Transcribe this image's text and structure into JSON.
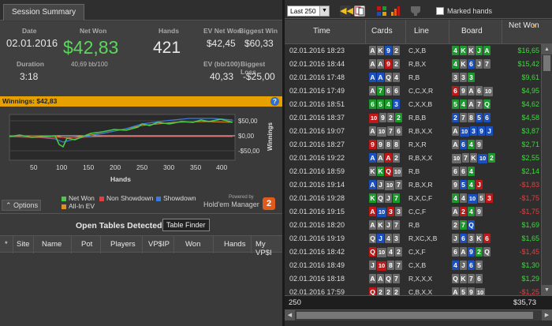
{
  "left": {
    "tab_label": "Session Summary",
    "summary": {
      "date_label": "Date",
      "date": "02.01.2016",
      "duration_label": "Duration",
      "duration": "3:18",
      "net_won_label": "Net Won",
      "net_won": "$42,83",
      "net_won_bb": "40,69 bb/100",
      "hands_label": "Hands",
      "hands": "421",
      "ev_net_won_label": "EV Net Won",
      "ev_net_won": "$42,45",
      "biggest_win_label": "Biggest Win",
      "biggest_win": "$60,33",
      "ev_bb_label": "EV (bb/100)",
      "ev_bb": "40,33",
      "biggest_loss_label": "Biggest Loss",
      "biggest_loss": "-$25,00"
    },
    "winnings_bar": "Winnings: $42,83",
    "graph": {
      "ytick_top": "$50,00",
      "ytick_mid": "$0,00",
      "ytick_bot": "-$50,00",
      "ylabel": "Winnings",
      "xticks": [
        "50",
        "100",
        "150",
        "200",
        "250",
        "300",
        "350",
        "400"
      ],
      "xlabel": "Hands"
    },
    "options_label": "Options",
    "legend": {
      "net_won": "Net Won",
      "non_showdown": "Non Showdown",
      "showdown": "Showdown",
      "all_in_ev": "All-In EV"
    },
    "powered_by": "Powered by",
    "brand": "Hold'em Manager",
    "brand_logo": "2",
    "open_tables": {
      "title": "Open Tables Detected",
      "finder_button": "Table Finder",
      "columns": [
        "*",
        "Site",
        "Name",
        "Pot",
        "Players",
        "VP$IP",
        "Won",
        "Hands",
        "My VP$I"
      ]
    }
  },
  "right": {
    "filter_select": "Last 250",
    "marked_hands_label": "Marked hands",
    "columns": {
      "time": "Time",
      "cards": "Cards",
      "line": "Line",
      "board": "Board",
      "net_won": "Net Won"
    },
    "rows": [
      {
        "time": "02.01.2016 18:23",
        "cards": [
          [
            "A",
            "s"
          ],
          [
            "K",
            "s"
          ],
          [
            "9",
            "d"
          ],
          [
            "2",
            "s"
          ]
        ],
        "line": "C,X,B",
        "board": [
          [
            "4",
            "c"
          ],
          [
            "K",
            "c"
          ],
          [
            "K",
            "s"
          ],
          [
            "J",
            "c"
          ],
          [
            "A",
            "c"
          ]
        ],
        "won": "$16,65",
        "color": "#3adc3a"
      },
      {
        "time": "02.01.2016 18:44",
        "cards": [
          [
            "A",
            "s"
          ],
          [
            "A",
            "s"
          ],
          [
            "9",
            "h"
          ],
          [
            "2",
            "s"
          ]
        ],
        "line": "R,B,X",
        "board": [
          [
            "4",
            "c"
          ],
          [
            "K",
            "s"
          ],
          [
            "6",
            "d"
          ],
          [
            "J",
            "s"
          ],
          [
            "7",
            "s"
          ]
        ],
        "won": "$15,42",
        "color": "#3adc3a"
      },
      {
        "time": "02.01.2016 17:48",
        "cards": [
          [
            "A",
            "d"
          ],
          [
            "A",
            "d"
          ],
          [
            "Q",
            "s"
          ],
          [
            "4",
            "s"
          ]
        ],
        "line": "R,B",
        "board": [
          [
            "3",
            "s"
          ],
          [
            "3",
            "s"
          ],
          [
            "3",
            "c"
          ]
        ],
        "won": "$9,61",
        "color": "#3adc3a"
      },
      {
        "time": "02.01.2016 17:49",
        "cards": [
          [
            "A",
            "s"
          ],
          [
            "7",
            "c"
          ],
          [
            "6",
            "s"
          ],
          [
            "6",
            "s"
          ]
        ],
        "line": "C,C,X,R",
        "board": [
          [
            "6",
            "h"
          ],
          [
            "9",
            "s"
          ],
          [
            "A",
            "s"
          ],
          [
            "6",
            "s"
          ],
          [
            "10",
            "s"
          ]
        ],
        "won": "$4,95",
        "color": "#3adc3a"
      },
      {
        "time": "02.01.2016 18:51",
        "cards": [
          [
            "6",
            "c"
          ],
          [
            "5",
            "c"
          ],
          [
            "4",
            "c"
          ],
          [
            "3",
            "d"
          ]
        ],
        "line": "C,X,X,B",
        "board": [
          [
            "5",
            "c"
          ],
          [
            "4",
            "c"
          ],
          [
            "A",
            "s"
          ],
          [
            "7",
            "s"
          ],
          [
            "Q",
            "c"
          ]
        ],
        "won": "$4,62",
        "color": "#3adc3a"
      },
      {
        "time": "02.01.2016 18:37",
        "cards": [
          [
            "10",
            "h"
          ],
          [
            "9",
            "s"
          ],
          [
            "2",
            "s"
          ],
          [
            "2",
            "c"
          ]
        ],
        "line": "R,B,B",
        "board": [
          [
            "2",
            "d"
          ],
          [
            "7",
            "s"
          ],
          [
            "8",
            "s"
          ],
          [
            "5",
            "d"
          ],
          [
            "6",
            "d"
          ]
        ],
        "won": "$4,58",
        "color": "#3adc3a"
      },
      {
        "time": "02.01.2016 19:07",
        "cards": [
          [
            "A",
            "s"
          ],
          [
            "10",
            "s"
          ],
          [
            "7",
            "s"
          ],
          [
            "6",
            "s"
          ]
        ],
        "line": "R,B,X,X",
        "board": [
          [
            "A",
            "s"
          ],
          [
            "10",
            "d"
          ],
          [
            "3",
            "d"
          ],
          [
            "9",
            "d"
          ],
          [
            "J",
            "d"
          ]
        ],
        "won": "$3,87",
        "color": "#3adc3a"
      },
      {
        "time": "02.01.2016 18:27",
        "cards": [
          [
            "9",
            "h"
          ],
          [
            "9",
            "s"
          ],
          [
            "8",
            "s"
          ],
          [
            "8",
            "s"
          ]
        ],
        "line": "R,X,R",
        "board": [
          [
            "A",
            "s"
          ],
          [
            "6",
            "d"
          ],
          [
            "4",
            "c"
          ],
          [
            "9",
            "s"
          ]
        ],
        "won": "$2,71",
        "color": "#3adc3a"
      },
      {
        "time": "02.01.2016 19:22",
        "cards": [
          [
            "A",
            "d"
          ],
          [
            "A",
            "s"
          ],
          [
            "A",
            "h"
          ],
          [
            "2",
            "s"
          ]
        ],
        "line": "R,B,X,X",
        "board": [
          [
            "10",
            "s"
          ],
          [
            "7",
            "s"
          ],
          [
            "K",
            "s"
          ],
          [
            "10",
            "d"
          ],
          [
            "2",
            "c"
          ]
        ],
        "won": "$2,55",
        "color": "#3adc3a"
      },
      {
        "time": "02.01.2016 18:59",
        "cards": [
          [
            "K",
            "s"
          ],
          [
            "K",
            "c"
          ],
          [
            "Q",
            "h"
          ],
          [
            "10",
            "s"
          ]
        ],
        "line": "R,B",
        "board": [
          [
            "6",
            "s"
          ],
          [
            "6",
            "s"
          ],
          [
            "4",
            "c"
          ]
        ],
        "won": "$2,14",
        "color": "#3adc3a"
      },
      {
        "time": "02.01.2016 19:14",
        "cards": [
          [
            "A",
            "d"
          ],
          [
            "J",
            "s"
          ],
          [
            "10",
            "s"
          ],
          [
            "7",
            "s"
          ]
        ],
        "line": "R,B,X,R",
        "board": [
          [
            "9",
            "s"
          ],
          [
            "5",
            "d"
          ],
          [
            "4",
            "c"
          ],
          [
            "J",
            "h"
          ]
        ],
        "won": "-$1,83",
        "color": "#e04040"
      },
      {
        "time": "02.01.2016 19:28",
        "cards": [
          [
            "K",
            "c"
          ],
          [
            "Q",
            "s"
          ],
          [
            "J",
            "s"
          ],
          [
            "7",
            "c"
          ]
        ],
        "line": "R,X,C,F",
        "board": [
          [
            "4",
            "c"
          ],
          [
            "4",
            "s"
          ],
          [
            "10",
            "d"
          ],
          [
            "5",
            "s"
          ],
          [
            "3",
            "h"
          ]
        ],
        "won": "-$1,75",
        "color": "#e04040"
      },
      {
        "time": "02.01.2016 19:15",
        "cards": [
          [
            "A",
            "h"
          ],
          [
            "10",
            "d"
          ],
          [
            "3",
            "h"
          ],
          [
            "3",
            "s"
          ]
        ],
        "line": "C,C,F",
        "board": [
          [
            "A",
            "s"
          ],
          [
            "2",
            "h"
          ],
          [
            "4",
            "c"
          ],
          [
            "9",
            "s"
          ]
        ],
        "won": "-$1,75",
        "color": "#e04040"
      },
      {
        "time": "02.01.2016 18:20",
        "cards": [
          [
            "A",
            "s"
          ],
          [
            "K",
            "s"
          ],
          [
            "J",
            "s"
          ],
          [
            "7",
            "s"
          ]
        ],
        "line": "R,B",
        "board": [
          [
            "2",
            "s"
          ],
          [
            "7",
            "c"
          ],
          [
            "Q",
            "d"
          ]
        ],
        "won": "$1,69",
        "color": "#3adc3a"
      },
      {
        "time": "02.01.2016 19:19",
        "cards": [
          [
            "Q",
            "s"
          ],
          [
            "J",
            "d"
          ],
          [
            "4",
            "s"
          ],
          [
            "3",
            "s"
          ]
        ],
        "line": "R,XC,X,B",
        "board": [
          [
            "J",
            "s"
          ],
          [
            "6",
            "d"
          ],
          [
            "3",
            "s"
          ],
          [
            "K",
            "s"
          ],
          [
            "6",
            "h"
          ]
        ],
        "won": "$1,65",
        "color": "#3adc3a"
      },
      {
        "time": "02.01.2016 18:42",
        "cards": [
          [
            "Q",
            "h"
          ],
          [
            "10",
            "s"
          ],
          [
            "4",
            "s"
          ],
          [
            "2",
            "s"
          ]
        ],
        "line": "C,X,F",
        "board": [
          [
            "6",
            "s"
          ],
          [
            "A",
            "s"
          ],
          [
            "9",
            "d"
          ],
          [
            "2",
            "c"
          ],
          [
            "Q",
            "s"
          ]
        ],
        "won": "-$1,45",
        "color": "#e04040"
      },
      {
        "time": "02.01.2016 18:49",
        "cards": [
          [
            "J",
            "s"
          ],
          [
            "10",
            "h"
          ],
          [
            "8",
            "s"
          ],
          [
            "7",
            "s"
          ]
        ],
        "line": "C,X,B",
        "board": [
          [
            "4",
            "d"
          ],
          [
            "J",
            "s"
          ],
          [
            "6",
            "d"
          ],
          [
            "5",
            "s"
          ]
        ],
        "won": "$1,30",
        "color": "#3adc3a"
      },
      {
        "time": "02.01.2016 18:18",
        "cards": [
          [
            "A",
            "s"
          ],
          [
            "A",
            "s"
          ],
          [
            "Q",
            "s"
          ],
          [
            "7",
            "s"
          ]
        ],
        "line": "R,X,X,X",
        "board": [
          [
            "Q",
            "s"
          ],
          [
            "K",
            "s"
          ],
          [
            "7",
            "s"
          ],
          [
            "6",
            "s"
          ]
        ],
        "won": "$1,29",
        "color": "#3adc3a"
      },
      {
        "time": "02.01.2016 17:59",
        "cards": [
          [
            "Q",
            "h"
          ],
          [
            "2",
            "s"
          ],
          [
            "2",
            "s"
          ],
          [
            "2",
            "s"
          ]
        ],
        "line": "C,B,X,X",
        "board": [
          [
            "A",
            "s"
          ],
          [
            "5",
            "s"
          ],
          [
            "9",
            "s"
          ],
          [
            "10",
            "s"
          ]
        ],
        "won": "-$1,25",
        "color": "#e04040"
      }
    ],
    "footer_count": "250",
    "footer_total": "$35,73"
  }
}
